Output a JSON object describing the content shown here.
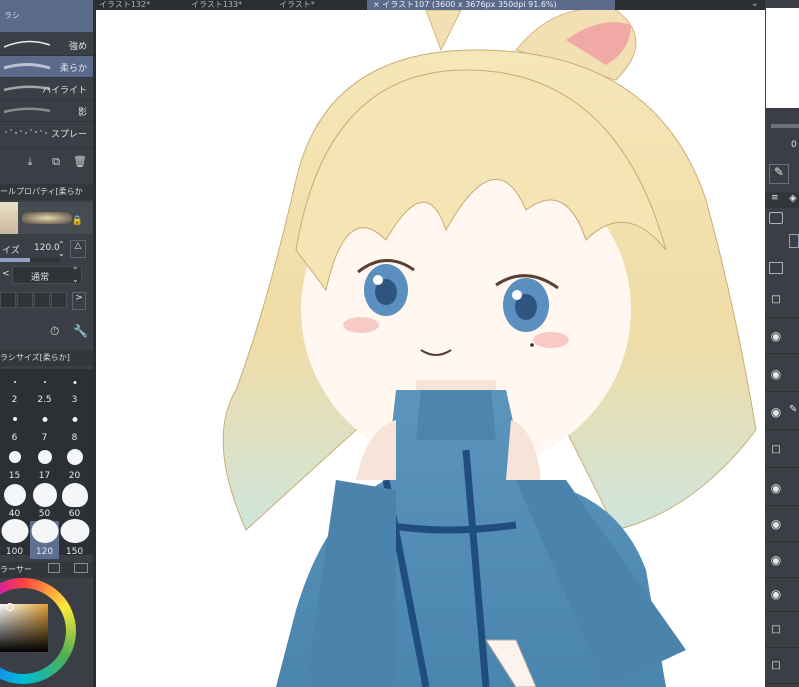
{
  "tabs": [
    {
      "label": "イラスト132*",
      "active": false
    },
    {
      "label": "イラスト133*",
      "active": false
    },
    {
      "label": "イラスト*",
      "active": false
    },
    {
      "label": "× イラスト107 (3600 x 3676px 350dpi 91.6%)",
      "active": true
    }
  ],
  "left_panel": {
    "top_header": "ラシ",
    "brushes": [
      {
        "label": "強め",
        "selected": false
      },
      {
        "label": "柔らか",
        "selected": true
      },
      {
        "label": "ハイライト",
        "selected": false
      },
      {
        "label": "影",
        "selected": false
      },
      {
        "label": "スプレー",
        "selected": false
      }
    ],
    "tool_property_header": "ールプロパティ[柔らか",
    "size_label": "イズ",
    "size_value": "120.0",
    "blend_mode": "通常",
    "brush_size_header": "ラシサイズ[柔らか]",
    "brush_sizes": [
      {
        "label": "2",
        "selected": false
      },
      {
        "label": "2.5",
        "selected": false
      },
      {
        "label": "3",
        "selected": false
      },
      {
        "label": "6",
        "selected": false
      },
      {
        "label": "7",
        "selected": false
      },
      {
        "label": "8",
        "selected": false
      },
      {
        "label": "15",
        "selected": false
      },
      {
        "label": "17",
        "selected": false
      },
      {
        "label": "20",
        "selected": false
      },
      {
        "label": "40",
        "selected": false
      },
      {
        "label": "50",
        "selected": false
      },
      {
        "label": "60",
        "selected": false
      },
      {
        "label": "100",
        "selected": false
      },
      {
        "label": "120",
        "selected": true
      },
      {
        "label": "150",
        "selected": false
      }
    ],
    "color_header": "ラーサー"
  },
  "right_panel": {
    "layer_zero_label": "0"
  },
  "icons": {
    "download": "download-icon",
    "duplicate": "duplicate-icon",
    "trash": "trash-icon",
    "lock": "lock-icon",
    "settings": "settings-icon",
    "wrench": "wrench-icon",
    "eyedropper": "eyedropper-icon",
    "eye": "eye-icon"
  },
  "colors": {
    "accent": "#5a6a8a",
    "panel": "#3b3f45",
    "hair": "#f3e3b0",
    "dress": "#4d86ad",
    "dress_trim": "#1f4e7e",
    "eye": "#5b8fc0"
  }
}
